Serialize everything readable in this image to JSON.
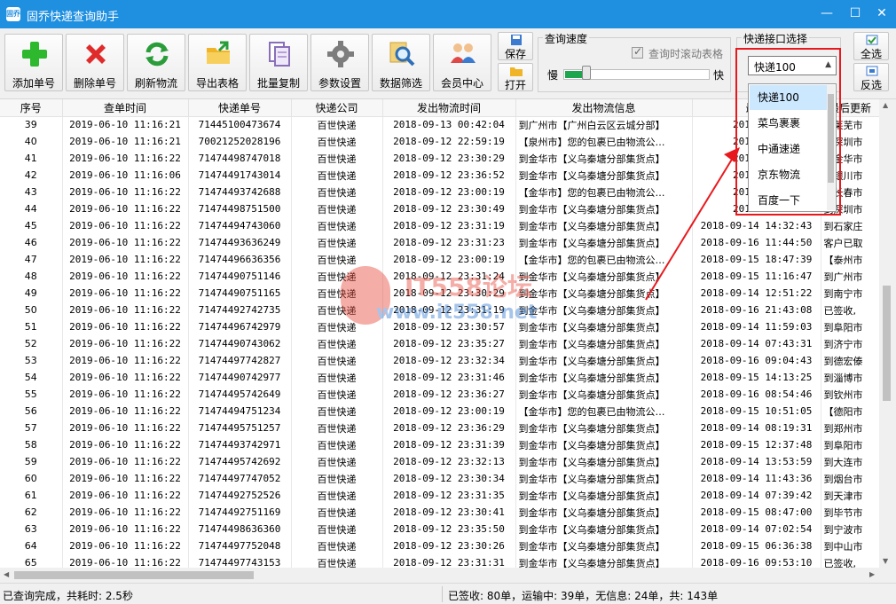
{
  "window": {
    "title": "固乔快递查询助手",
    "icon_text": "固乔"
  },
  "toolbar": {
    "buttons": [
      {
        "label": "添加单号",
        "icon": "plus-icon"
      },
      {
        "label": "删除单号",
        "icon": "delete-x-icon"
      },
      {
        "label": "刷新物流",
        "icon": "refresh-icon"
      },
      {
        "label": "导出表格",
        "icon": "folder-export-icon"
      },
      {
        "label": "批量复制",
        "icon": "copy-icon"
      },
      {
        "label": "参数设置",
        "icon": "gear-icon"
      },
      {
        "label": "数据筛选",
        "icon": "magnifier-filter-icon"
      },
      {
        "label": "会员中心",
        "icon": "users-icon"
      }
    ],
    "save_label": "保存",
    "open_label": "打开",
    "select_all_label": "全选",
    "invert_label": "反选"
  },
  "speed": {
    "group_title": "查询速度",
    "scroll_checkbox_label": "查询时滚动表格",
    "slow_label": "慢",
    "fast_label": "快",
    "level_fraction": 0.12
  },
  "api": {
    "group_title": "快递接口选择",
    "selected": "快递100",
    "options": [
      "快递100",
      "菜鸟裹裹",
      "中通速递",
      "京东物流",
      "百度一下"
    ]
  },
  "table": {
    "columns": [
      "序号",
      "查单时间",
      "快递单号",
      "快递公司",
      "发出物流时间",
      "发出物流信息",
      "最后",
      "最后更新"
    ],
    "rows": [
      [
        "39",
        "2019-06-10 11:16:21",
        "71445100473674",
        "百世快递",
        "2018-09-13 00:42:04",
        "到广州市【广州白云区云城分部】",
        "2018-09-",
        "到莱芜市"
      ],
      [
        "40",
        "2019-06-10 11:16:21",
        "70021252028196",
        "百世快递",
        "2018-09-12 22:59:19",
        "【泉州市】您的包裹已由物流公…",
        "2018-09-",
        "【深圳市"
      ],
      [
        "41",
        "2019-06-10 11:16:22",
        "71474498747018",
        "百世快递",
        "2018-09-12 23:30:29",
        "到金华市【义乌秦塘分部集货点】",
        "2018-09-",
        "到金华市"
      ],
      [
        "42",
        "2019-06-10 11:16:06",
        "71474491743014",
        "百世快递",
        "2018-09-12 23:36:52",
        "到金华市【义乌秦塘分部集货点】",
        "2018-09-",
        "到银川市"
      ],
      [
        "43",
        "2019-06-10 11:16:22",
        "71474493742688",
        "百世快递",
        "2018-09-12 23:00:19",
        "【金华市】您的包裹已由物流公…",
        "2018-09-",
        "【长春市"
      ],
      [
        "44",
        "2019-06-10 11:16:22",
        "71474498751500",
        "百世快递",
        "2018-09-12 23:30:49",
        "到金华市【义乌秦塘分部集货点】",
        "2018-09-",
        "到深圳市"
      ],
      [
        "45",
        "2019-06-10 11:16:22",
        "71474494743060",
        "百世快递",
        "2018-09-12 23:31:19",
        "到金华市【义乌秦塘分部集货点】",
        "2018-09-14 14:32:43",
        "到石家庄"
      ],
      [
        "46",
        "2019-06-10 11:16:22",
        "71474493636249",
        "百世快递",
        "2018-09-12 23:31:23",
        "到金华市【义乌秦塘分部集货点】",
        "2018-09-16 11:44:50",
        "客户已取"
      ],
      [
        "47",
        "2019-06-10 11:16:22",
        "71474496636356",
        "百世快递",
        "2018-09-12 23:00:19",
        "【金华市】您的包裹已由物流公…",
        "2018-09-15 18:47:39",
        "【泰州市"
      ],
      [
        "48",
        "2019-06-10 11:16:22",
        "71474490751146",
        "百世快递",
        "2018-09-12 23:31:24",
        "到金华市【义乌秦塘分部集货点】",
        "2018-09-15 11:16:47",
        "到广州市"
      ],
      [
        "49",
        "2019-06-10 11:16:22",
        "71474490751165",
        "百世快递",
        "2018-09-12 23:30:29",
        "到金华市【义乌秦塘分部集货点】",
        "2018-09-14 12:51:22",
        "到南宁市"
      ],
      [
        "50",
        "2019-06-10 11:16:22",
        "71474492742735",
        "百世快递",
        "2018-09-12 23:31:19",
        "到金华市【义乌秦塘分部集货点】",
        "2018-09-16 21:43:08",
        "已签收,"
      ],
      [
        "51",
        "2019-06-10 11:16:22",
        "71474496742979",
        "百世快递",
        "2018-09-12 23:30:57",
        "到金华市【义乌秦塘分部集货点】",
        "2018-09-14 11:59:03",
        "到阜阳市"
      ],
      [
        "52",
        "2019-06-10 11:16:22",
        "71474490743062",
        "百世快递",
        "2018-09-12 23:35:27",
        "到金华市【义乌秦塘分部集货点】",
        "2018-09-14 07:43:31",
        "到济宁市"
      ],
      [
        "53",
        "2019-06-10 11:16:22",
        "71474497742827",
        "百世快递",
        "2018-09-12 23:32:34",
        "到金华市【义乌秦塘分部集货点】",
        "2018-09-16 09:04:43",
        "到德宏傣"
      ],
      [
        "54",
        "2019-06-10 11:16:22",
        "71474490742977",
        "百世快递",
        "2018-09-12 23:31:46",
        "到金华市【义乌秦塘分部集货点】",
        "2018-09-15 14:13:25",
        "到淄博市"
      ],
      [
        "55",
        "2019-06-10 11:16:22",
        "71474495742649",
        "百世快递",
        "2018-09-12 23:36:27",
        "到金华市【义乌秦塘分部集货点】",
        "2018-09-16 08:54:46",
        "到钦州市"
      ],
      [
        "56",
        "2019-06-10 11:16:22",
        "71474494751234",
        "百世快递",
        "2018-09-12 23:00:19",
        "【金华市】您的包裹已由物流公…",
        "2018-09-15 10:51:05",
        "【德阳市"
      ],
      [
        "57",
        "2019-06-10 11:16:22",
        "71474495751257",
        "百世快递",
        "2018-09-12 23:36:29",
        "到金华市【义乌秦塘分部集货点】",
        "2018-09-14 08:19:31",
        "到郑州市"
      ],
      [
        "58",
        "2019-06-10 11:16:22",
        "71474493742971",
        "百世快递",
        "2018-09-12 23:31:39",
        "到金华市【义乌秦塘分部集货点】",
        "2018-09-15 12:37:48",
        "到阜阳市"
      ],
      [
        "59",
        "2019-06-10 11:16:22",
        "71474495742692",
        "百世快递",
        "2018-09-12 23:32:13",
        "到金华市【义乌秦塘分部集货点】",
        "2018-09-14 13:53:59",
        "到大连市"
      ],
      [
        "60",
        "2019-06-10 11:16:22",
        "71474497747052",
        "百世快递",
        "2018-09-12 23:30:34",
        "到金华市【义乌秦塘分部集货点】",
        "2018-09-14 11:43:36",
        "到烟台市"
      ],
      [
        "61",
        "2019-06-10 11:16:22",
        "71474492752526",
        "百世快递",
        "2018-09-12 23:31:35",
        "到金华市【义乌秦塘分部集货点】",
        "2018-09-14 07:39:42",
        "到天津市"
      ],
      [
        "62",
        "2019-06-10 11:16:22",
        "71474492751169",
        "百世快递",
        "2018-09-12 23:30:41",
        "到金华市【义乌秦塘分部集货点】",
        "2018-09-15 08:47:00",
        "到毕节市"
      ],
      [
        "63",
        "2019-06-10 11:16:22",
        "71474498636360",
        "百世快递",
        "2018-09-12 23:35:50",
        "到金华市【义乌秦塘分部集货点】",
        "2018-09-14 07:02:54",
        "到宁波市"
      ],
      [
        "64",
        "2019-06-10 11:16:22",
        "71474497752048",
        "百世快递",
        "2018-09-12 23:30:26",
        "到金华市【义乌秦塘分部集货点】",
        "2018-09-15 06:36:38",
        "到中山市"
      ],
      [
        "65",
        "2019-06-10 11:16:22",
        "71474497743153",
        "百世快递",
        "2018-09-12 23:31:31",
        "到金华市【义乌秦塘分部集货点】",
        "2018-09-16 09:53:10",
        "已签收,"
      ]
    ]
  },
  "watermark": {
    "brand": "IT558论坛",
    "url": "www.it558.net"
  },
  "status": {
    "left": "已查询完成，共耗时: 2.5秒",
    "right": "已签收: 80单，运输中: 39单，无信息: 24单，共: 143单"
  },
  "colors": {
    "title_bar": "#1f8fe0",
    "highlight_box": "#e8191e",
    "speed_fill": "#1ea64f",
    "selected_option": "#cce8ff"
  }
}
